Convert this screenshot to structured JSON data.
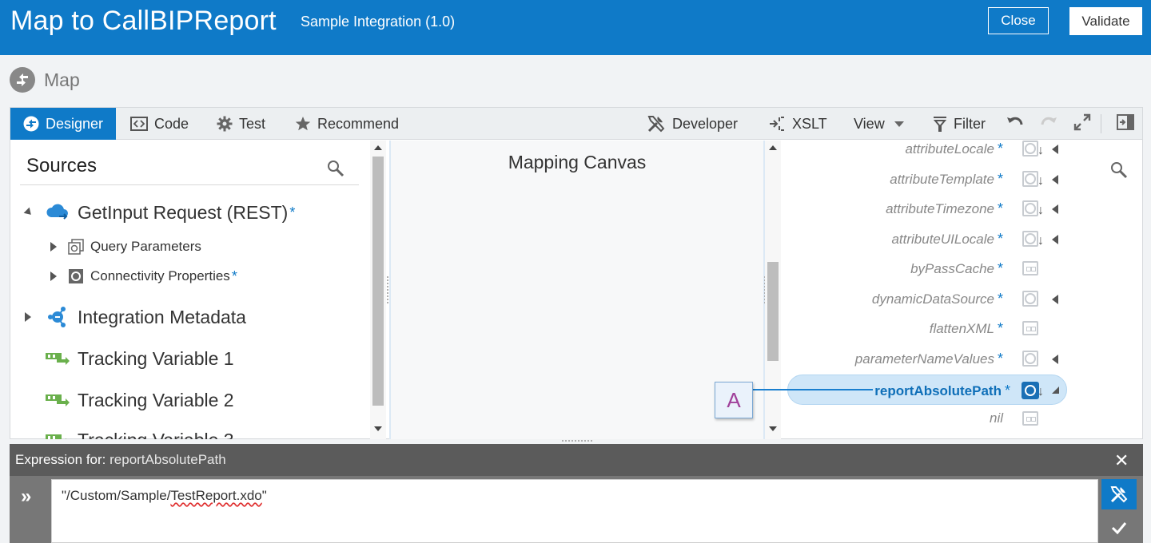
{
  "header": {
    "title": "Map to CallBIPReport",
    "subtitle": "Sample Integration (1.0)",
    "close_label": "Close",
    "validate_label": "Validate"
  },
  "breadcrumb": {
    "label": "Map"
  },
  "toolbar": {
    "designer": "Designer",
    "code": "Code",
    "test": "Test",
    "recommend": "Recommend",
    "developer": "Developer",
    "xslt": "XSLT",
    "view": "View",
    "filter": "Filter"
  },
  "sources": {
    "title": "Sources",
    "tree": {
      "getinput": "GetInput Request (REST)",
      "query_params": "Query Parameters",
      "connectivity": "Connectivity Properties",
      "metadata": "Integration Metadata",
      "tracking1": "Tracking Variable 1",
      "tracking2": "Tracking Variable 2",
      "tracking3": "Tracking Variable 3"
    },
    "required_mark": "*"
  },
  "canvas": {
    "title": "Mapping Canvas"
  },
  "target": {
    "items": [
      {
        "label": "attributeLocale",
        "kind": "element"
      },
      {
        "label": "attributeTemplate",
        "kind": "element"
      },
      {
        "label": "attributeTimezone",
        "kind": "element"
      },
      {
        "label": "attributeUILocale",
        "kind": "element"
      },
      {
        "label": "byPassCache",
        "kind": "attribute"
      },
      {
        "label": "dynamicDataSource",
        "kind": "element"
      },
      {
        "label": "flattenXML",
        "kind": "attribute"
      },
      {
        "label": "parameterNameValues",
        "kind": "element"
      },
      {
        "label": "reportAbsolutePath",
        "kind": "element",
        "selected": true
      },
      {
        "label": "nil",
        "kind": "attribute"
      }
    ],
    "required_mark": "*",
    "mapped_marker": "A"
  },
  "expression": {
    "label": "Expression for:",
    "field": "reportAbsolutePath",
    "value_prefix": "\"/Custom/Sample/",
    "value_file": "TestReport.xdo",
    "value_suffix": "\""
  },
  "colors": {
    "accent": "#0f7ac8",
    "expression_bar": "#5b5b5b"
  }
}
